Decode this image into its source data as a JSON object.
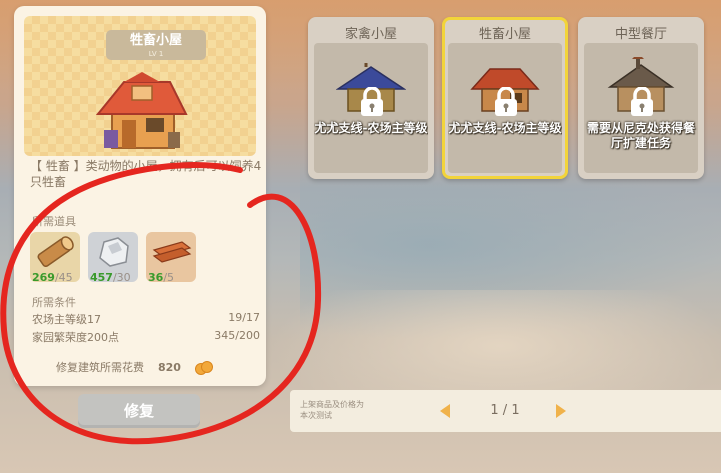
{
  "detail": {
    "title": "牲畜小屋",
    "level": "LV 1",
    "description": "【 牲畜 】类动物的小屋，拥有后可以饲养4只牲畜",
    "materials_label": "所需道具",
    "materials": [
      {
        "icon": "wood-log-icon",
        "have": "269",
        "need": "/45"
      },
      {
        "icon": "stone-icon",
        "have": "457",
        "need": "/30"
      },
      {
        "icon": "plank-icon",
        "have": "36",
        "need": "/5"
      }
    ],
    "conditions_label": "所需条件",
    "conditions": [
      {
        "label": "农场主等级17",
        "value": "19/17"
      },
      {
        "label": "家园繁荣度200点",
        "value": "345/200"
      }
    ],
    "cost_label": "修复建筑所需花费",
    "cost_value": "820",
    "cost_icon": "coin-icon",
    "repair_button": "修复"
  },
  "cards": [
    {
      "name": "家禽小屋",
      "desc": "尤尤支线-农场主等级",
      "selected": false
    },
    {
      "name": "牲畜小屋",
      "desc": "尤尤支线-农场主等级",
      "selected": true
    },
    {
      "name": "中型餐厅",
      "desc": "需要从尼克处获得餐厅扩建任务",
      "selected": false
    }
  ],
  "pager": {
    "note": "上架商品及价格为本次测试",
    "page": "1 / 1"
  },
  "colors": {
    "accent_yellow": "#f2d43a",
    "have_green": "#3a9a2c",
    "annotation_red": "#e5261f"
  }
}
